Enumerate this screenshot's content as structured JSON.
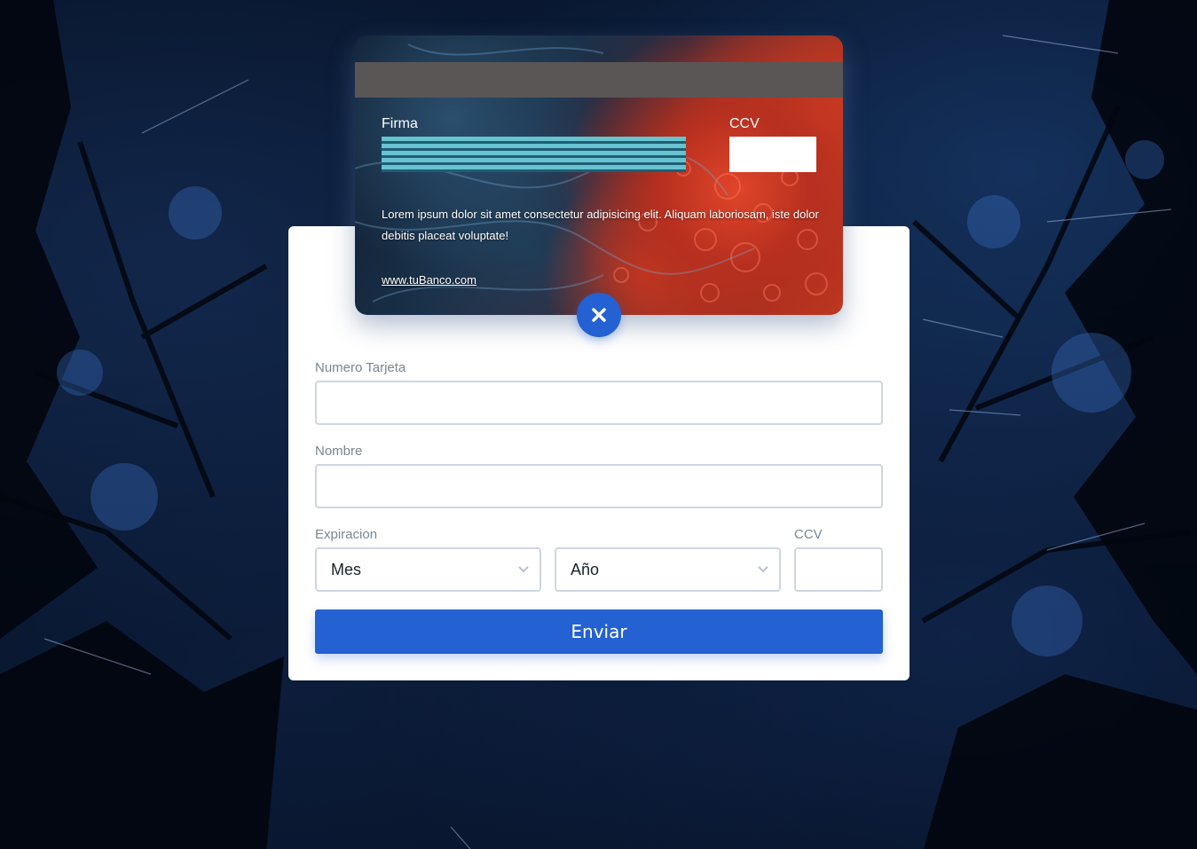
{
  "card": {
    "signature_label": "Firma",
    "ccv_label": "CCV",
    "text": "Lorem ipsum dolor sit amet consectetur adipisicing elit. Aliquam laboriosam, iste dolor debitis placeat voluptate!",
    "link": "www.tuBanco.com"
  },
  "toggle": {
    "icon": "close-icon",
    "color": "#2461d2"
  },
  "form": {
    "card_number": {
      "label": "Numero Tarjeta",
      "value": ""
    },
    "name": {
      "label": "Nombre",
      "value": ""
    },
    "expiration": {
      "label": "Expiracion",
      "month_selected": "Mes",
      "year_selected": "Año"
    },
    "ccv": {
      "label": "CCV",
      "value": ""
    },
    "submit_label": "Enviar"
  },
  "colors": {
    "accent": "#2461d2",
    "panel": "#ffffff",
    "label": "#7a8592",
    "border": "#ced6e0"
  }
}
